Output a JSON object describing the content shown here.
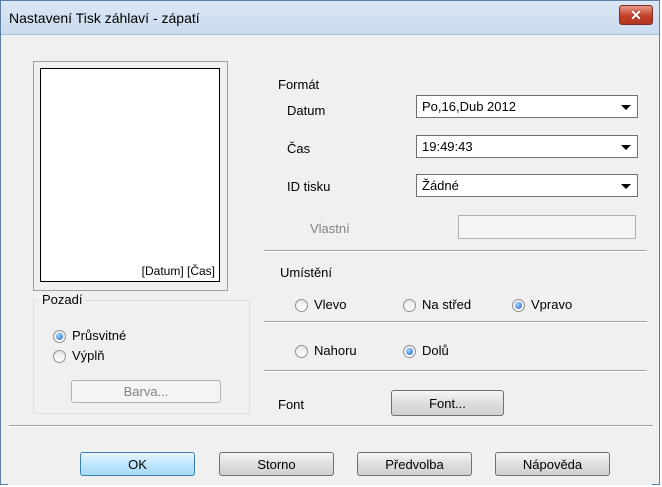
{
  "window": {
    "title": "Nastavení Tisk záhlaví - zápatí",
    "close_glyph": "✕"
  },
  "preview": {
    "text": "[Datum] [Čas]"
  },
  "background_group": {
    "label": "Pozadí",
    "options": [
      {
        "label": "Průsvitné",
        "checked": true
      },
      {
        "label": "Výplň",
        "checked": false
      }
    ],
    "color_button": "Barva..."
  },
  "format": {
    "label": "Formát",
    "date_label": "Datum",
    "date_value": "Po,16,Dub 2012",
    "time_label": "Čas",
    "time_value": "19:49:43",
    "print_id_label": "ID tisku",
    "print_id_value": "Žádné",
    "custom_label": "Vlastní",
    "custom_value": ""
  },
  "placement": {
    "label": "Umístění",
    "horizontal": [
      {
        "label": "Vlevo",
        "checked": false
      },
      {
        "label": "Na střed",
        "checked": false
      },
      {
        "label": "Vpravo",
        "checked": true
      }
    ],
    "vertical": [
      {
        "label": "Nahoru",
        "checked": false
      },
      {
        "label": "Dolů",
        "checked": true
      }
    ]
  },
  "font": {
    "label": "Font",
    "button": "Font..."
  },
  "buttons": {
    "ok": "OK",
    "cancel": "Storno",
    "defaults": "Předvolba",
    "help": "Nápověda"
  }
}
